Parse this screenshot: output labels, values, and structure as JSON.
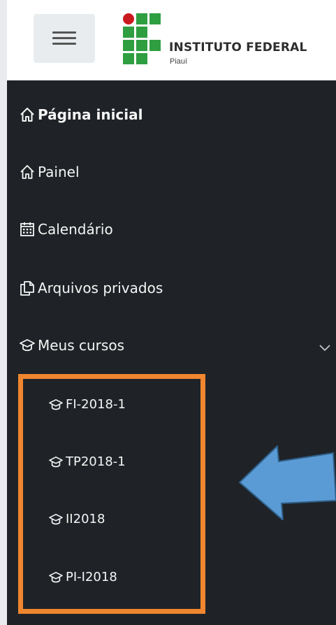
{
  "header": {
    "menu_toggle": "hamburger-icon",
    "logo": {
      "name": "INSTITUTO FEDERAL",
      "campus": "Piauí"
    }
  },
  "nav": {
    "items": [
      {
        "label": "Página inicial",
        "icon": "home-icon",
        "bold": true
      },
      {
        "label": "Painel",
        "icon": "home-icon"
      },
      {
        "label": "Calendário",
        "icon": "calendar-icon"
      },
      {
        "label": "Arquivos privados",
        "icon": "files-icon"
      },
      {
        "label": "Meus cursos",
        "icon": "graduation-cap-icon",
        "expandable": true
      }
    ],
    "courses": [
      {
        "label": "FI-2018-1",
        "icon": "graduation-cap-icon"
      },
      {
        "label": "TP2018-1",
        "icon": "graduation-cap-icon"
      },
      {
        "label": "II2018",
        "icon": "graduation-cap-icon"
      },
      {
        "label": "PI-I2018",
        "icon": "graduation-cap-icon"
      }
    ]
  },
  "annotation": {
    "highlight_color": "#f0862f",
    "arrow_color": "#5b9bd5"
  },
  "colors": {
    "drawer_bg": "#1f2327",
    "header_bg": "#ffffff",
    "logo_green": "#2f9e41",
    "logo_red": "#c8191e"
  }
}
